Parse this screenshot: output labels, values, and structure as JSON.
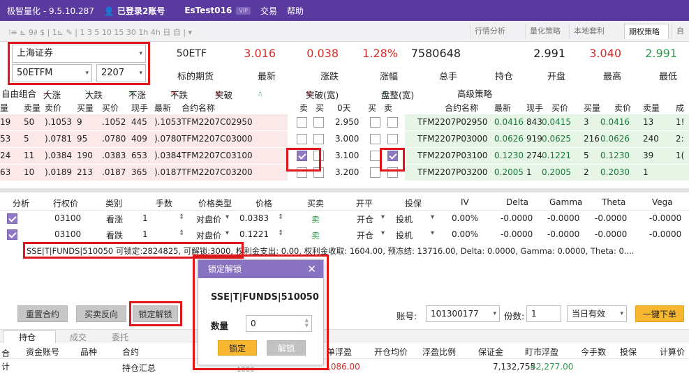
{
  "titlebar": {
    "app": "极智量化 - 9.5.10.287",
    "user": "已登录2账号",
    "account": "EsTest016",
    "vip": "VIP",
    "menu": [
      "交易",
      "帮助"
    ]
  },
  "toolbar": {
    "timeframes": "⁝≡ ⊾ 9∂ $ | 1⊾ ✎ | 1 3 5 10 15 30 1h 4h 日 自 | ▾",
    "tabs": [
      "行情分析",
      "量化策略",
      "本地套利",
      "期权策略",
      "自"
    ],
    "active_tab": "期权策略"
  },
  "selectors": {
    "exchange": "上海证券",
    "contract": "50ETFM",
    "month": "2207"
  },
  "quote": {
    "name": "50ETF",
    "name_label": "标的期货",
    "last": "3.016",
    "last_label": "最新",
    "change": "0.038",
    "change_label": "涨跌",
    "pct": "1.28%",
    "pct_label": "涨幅",
    "volume": "7580648",
    "volume_label": "总手",
    "oi_label": "持仓",
    "open": "2.991",
    "open_label": "开盘",
    "high": "3.040",
    "high_label": "最高",
    "low": "2.991",
    "low_label": "最低"
  },
  "strategies": [
    "自由组合",
    "大涨",
    "大跌",
    "不涨",
    "不跌",
    "突破",
    "盘整",
    "突破(宽)",
    "盘整(宽)",
    "高级策略"
  ],
  "chain": {
    "headers_left": [
      "量",
      "卖量",
      "卖价",
      "买量",
      "买价",
      "现手",
      "最新",
      "合约名称"
    ],
    "headers_mid": [
      "卖",
      "买",
      "0天",
      "买",
      "卖"
    ],
    "headers_right": [
      "合约名称",
      "最新",
      "现手",
      "买价",
      "买量",
      "卖价",
      "卖量",
      "成"
    ],
    "rows": [
      {
        "l": [
          "19",
          "50",
          ").1053",
          "9",
          ".1052",
          "445",
          ").1053",
          "TFM2207C02950"
        ],
        "strike": "2.950",
        "r": [
          "TFM2207P02950",
          "0.0416",
          "843",
          "0.0415",
          "3",
          "0.0416",
          "13",
          "1!"
        ],
        "ck1": false,
        "ck2": false
      },
      {
        "l": [
          "53",
          "5",
          ").0781",
          "95",
          ".0780",
          "409",
          ").0780",
          "TFM2207C03000"
        ],
        "strike": "3.000",
        "r": [
          "TFM2207P03000",
          "0.0626",
          "919",
          "0.0625",
          "216",
          "0.0626",
          "240",
          "2:"
        ],
        "ck1": false,
        "ck2": false
      },
      {
        "l": [
          "24",
          "11",
          ").0384",
          "190",
          ".0383",
          "653",
          ").0384",
          "TFM2207C03100"
        ],
        "strike": "3.100",
        "r": [
          "TFM2207P03100",
          "0.1230",
          "274",
          "0.1221",
          "5",
          "0.1230",
          "39",
          "1("
        ],
        "ck1": true,
        "ck2": true
      },
      {
        "l": [
          "63",
          "10",
          ").0189",
          "213",
          ".0187",
          "365",
          ").0187",
          "TFM2207C03200"
        ],
        "strike": "3.200",
        "r": [
          "TFM2207P03200",
          "0.2005",
          "1",
          "0.2005",
          "2",
          "0.2030",
          "1",
          ""
        ],
        "ck1": false,
        "ck2": false
      }
    ]
  },
  "orders": {
    "headers": [
      "分析",
      "行权价",
      "类别",
      "手数",
      "价格类型",
      "价格",
      "买卖",
      "开平",
      "投保",
      "IV",
      "Delta",
      "Gamma",
      "Theta",
      "Vega"
    ],
    "rows": [
      {
        "strike": "03100",
        "type": "看涨",
        "qty": "1",
        "ptype": "对盘价",
        "price": "0.0383",
        "side": "卖",
        "oc": "开仓",
        "hedge": "投机",
        "iv": "0.00%",
        "delta": "-0.0000",
        "gamma": "-0.0000",
        "theta": "-0.0000",
        "vega": "-0.0000"
      },
      {
        "strike": "03100",
        "type": "看跌",
        "qty": "1",
        "ptype": "对盘价",
        "price": "0.1221",
        "side": "卖",
        "oc": "开仓",
        "hedge": "投机",
        "iv": "0.00%",
        "delta": "-0.0000",
        "gamma": "-0.0000",
        "theta": "-0.0000",
        "vega": "-0.0000"
      }
    ]
  },
  "summary": "SSE|T|FUNDS|510050 可锁定:2824825, 可解锁:3000, 权利金支出: 0.00, 权利金收取: 1604.00, 预冻结: 13716.00, Delta: 0.0000, Gamma: 0.0000, Theta: 0....",
  "actions": {
    "reset": "重置合约",
    "reverse": "买卖反向",
    "lock": "锁定解锁",
    "account_label": "账号:",
    "account": "101300177",
    "copies_label": "份数:",
    "copies": "1",
    "validity": "当日有效",
    "submit": "一键下单"
  },
  "positions": {
    "tabs": [
      "持仓",
      "成交",
      "委托"
    ],
    "headers": [
      "合",
      "资金账号",
      "品种",
      "合约",
      "单浮盈",
      "开仓均价",
      "浮盈比例",
      "保证金",
      "盯市浮盈",
      "今手数",
      "投保",
      "计算价"
    ],
    "row": {
      "c0": "计",
      "contract": "持仓汇总",
      "float": ",086.00",
      "margin": "7,132,755.",
      "mtm": "-42,277.00",
      "qty": "1000"
    }
  },
  "dialog": {
    "title": "锁定解锁",
    "code": "SSE|T|FUNDS|510050",
    "qty_label": "数量",
    "qty": "0",
    "lock": "锁定",
    "unlock": "解锁"
  }
}
